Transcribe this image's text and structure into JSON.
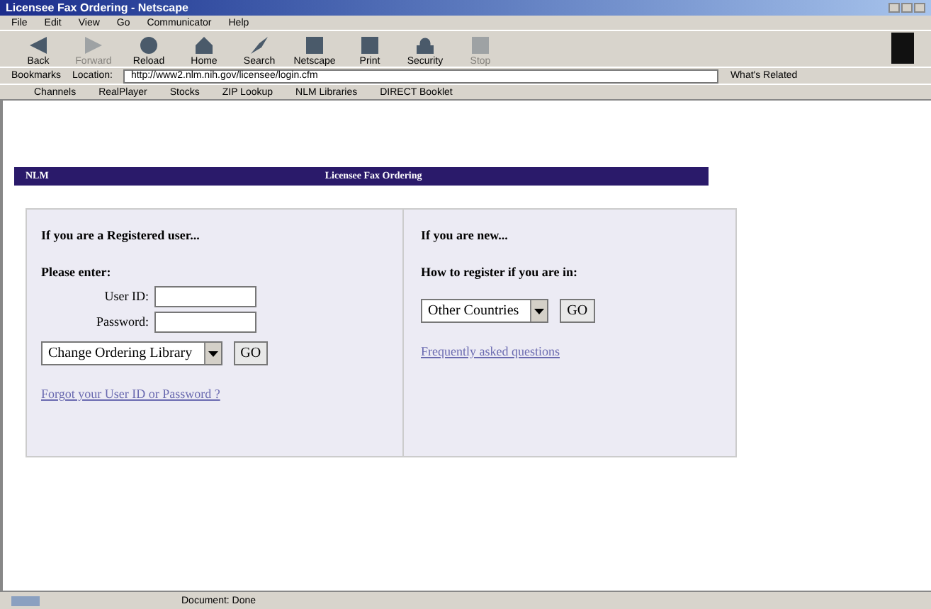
{
  "window": {
    "title": "Licensee Fax Ordering - Netscape"
  },
  "menu": [
    "File",
    "Edit",
    "View",
    "Go",
    "Communicator",
    "Help"
  ],
  "toolbar": [
    {
      "label": "Back",
      "disabled": false
    },
    {
      "label": "Forward",
      "disabled": true
    },
    {
      "label": "Reload",
      "disabled": false
    },
    {
      "label": "Home",
      "disabled": false
    },
    {
      "label": "Search",
      "disabled": false
    },
    {
      "label": "Netscape",
      "disabled": false
    },
    {
      "label": "Print",
      "disabled": false
    },
    {
      "label": "Security",
      "disabled": false
    },
    {
      "label": "Stop",
      "disabled": true
    }
  ],
  "location": {
    "bookmarks": "Bookmarks",
    "label": "Location:",
    "url": "http://www2.nlm.nih.gov/licensee/login.cfm",
    "related": "What's Related"
  },
  "personal_toolbar": [
    "Channels",
    "RealPlayer",
    "Stocks",
    "ZIP Lookup",
    "NLM Libraries",
    "DIRECT Booklet"
  ],
  "page": {
    "header_left": "NLM",
    "header_title": "Licensee Fax Ordering",
    "registered": {
      "heading": "If you are a Registered user...",
      "prompt": "Please enter:",
      "user_id_label": "User ID:",
      "password_label": "Password:",
      "select": "Change Ordering Library",
      "go": "GO",
      "link": "Forgot your User ID or Password ?"
    },
    "new_user": {
      "heading": "If you are new...",
      "prompt": "How to register if you are in:",
      "select": "Other Countries",
      "go": "GO",
      "link": "Frequently asked questions"
    }
  },
  "status_bar": {
    "text": "Document: Done"
  }
}
